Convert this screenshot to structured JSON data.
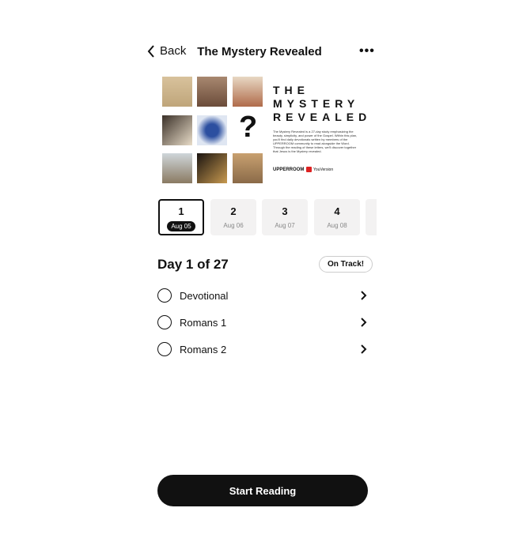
{
  "header": {
    "back_label": "Back",
    "title": "The Mystery Revealed",
    "more_icon": "ellipsis-icon"
  },
  "cover": {
    "title_lines": [
      "THE",
      "MYSTERY",
      "REVEALED"
    ],
    "question_mark": "?",
    "description": "The Mystery Revealed is a 27-day study emphasizing the beauty, simplicity, and power of the Gospel. Within this plan, you'll find daily devotionals written by members of the UPPERROOM community to read alongside the Word. Through the reading of these letters, we'll discover together that Jesus is the Mystery revealed.",
    "logo_upperroom": "UPPERROOM",
    "logo_youversion": "YouVersion"
  },
  "days": [
    {
      "number": "1",
      "date": "Aug 05",
      "selected": true
    },
    {
      "number": "2",
      "date": "Aug 06"
    },
    {
      "number": "3",
      "date": "Aug 07"
    },
    {
      "number": "4",
      "date": "Aug 08"
    }
  ],
  "progress": {
    "title": "Day 1 of 27",
    "status": "On Track!"
  },
  "readings": [
    {
      "label": "Devotional"
    },
    {
      "label": "Romans 1"
    },
    {
      "label": "Romans 2"
    }
  ],
  "start_button": "Start Reading"
}
